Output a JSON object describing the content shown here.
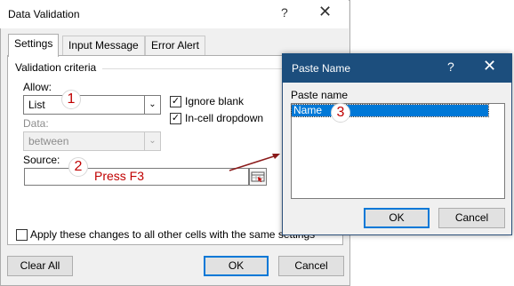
{
  "data_validation": {
    "title": "Data Validation",
    "help_glyph": "?",
    "close_glyph": "✕",
    "tabs": [
      {
        "label": "Settings",
        "active": true
      },
      {
        "label": "Input Message",
        "active": false
      },
      {
        "label": "Error Alert",
        "active": false
      }
    ],
    "group_label": "Validation criteria",
    "allow": {
      "label": "Allow:",
      "value": "List"
    },
    "data": {
      "label": "Data:",
      "value": "between",
      "disabled": true
    },
    "ignore_blank": {
      "label": "Ignore blank",
      "checked": true
    },
    "in_cell_dropdown": {
      "label": "In-cell dropdown",
      "checked": true
    },
    "source": {
      "label": "Source:",
      "value": ""
    },
    "apply_all": {
      "label": "Apply these changes to all other cells with the same settings",
      "checked": false
    },
    "buttons": {
      "clear_all": "Clear All",
      "ok": "OK",
      "cancel": "Cancel"
    },
    "check_glyph": "✓",
    "arrow_glyph": "⌄"
  },
  "paste_name": {
    "title": "Paste Name",
    "help_glyph": "?",
    "close_glyph": "✕",
    "list_label": "Paste name",
    "items": [
      "Name"
    ],
    "buttons": {
      "ok": "OK",
      "cancel": "Cancel"
    }
  },
  "annotations": {
    "step1": "1",
    "step2": "2",
    "step3": "3",
    "instruction": "Press F3",
    "color": "#c00000"
  },
  "colors": {
    "accent": "#0078d7",
    "titlebar": "#1c4e7d"
  }
}
